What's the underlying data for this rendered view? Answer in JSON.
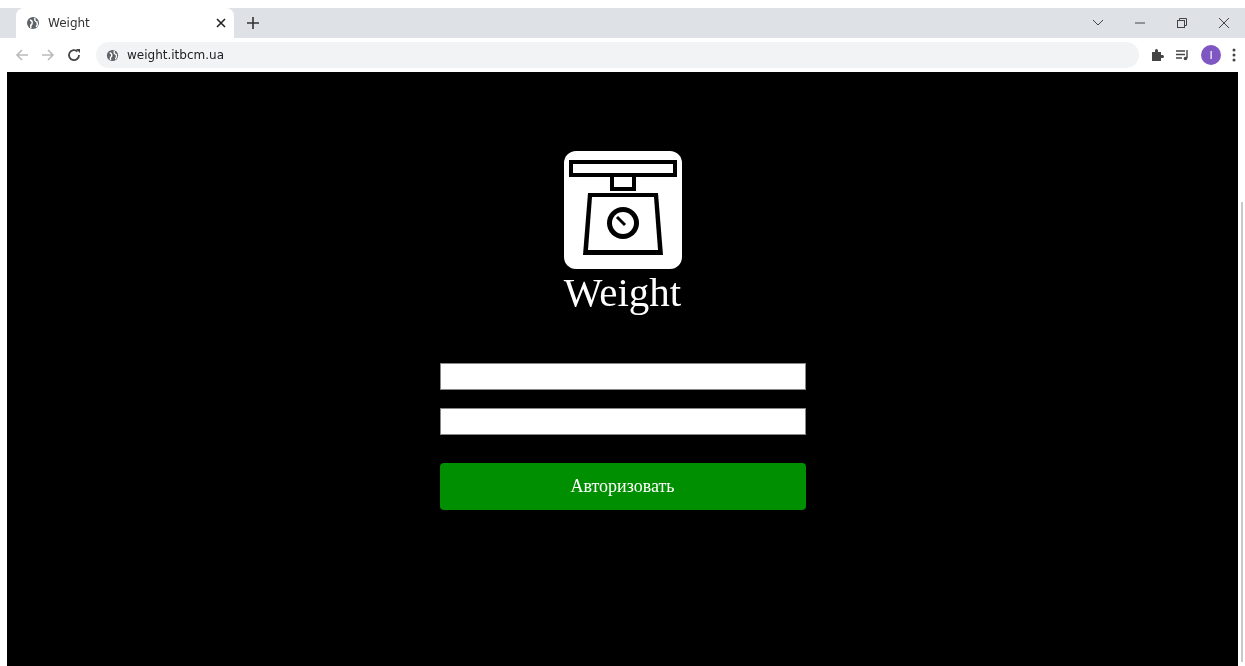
{
  "browser": {
    "tab": {
      "title": "Weight",
      "selected": true
    },
    "address": "weight.itbcm.ua",
    "profile": "I"
  },
  "page": {
    "title": "Weight",
    "button": "Авторизовать"
  }
}
